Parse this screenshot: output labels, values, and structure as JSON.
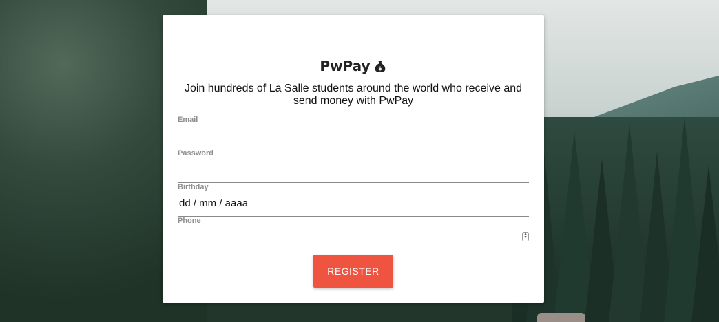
{
  "brand": {
    "name": "PwPay",
    "icon": "money-bag-icon"
  },
  "subtitle": "Join hundreds of La Salle students around the world who receive and send money with PwPay",
  "form": {
    "email": {
      "label": "Email",
      "value": ""
    },
    "password": {
      "label": "Password",
      "value": ""
    },
    "birthday": {
      "label": "Birthday",
      "value": "dd / mm / aaaa"
    },
    "phone": {
      "label": "Phone",
      "value": ""
    }
  },
  "register_button": "REGISTER",
  "colors": {
    "button": "#ee5440",
    "card": "#ffffff",
    "label": "#8f8f8f"
  }
}
